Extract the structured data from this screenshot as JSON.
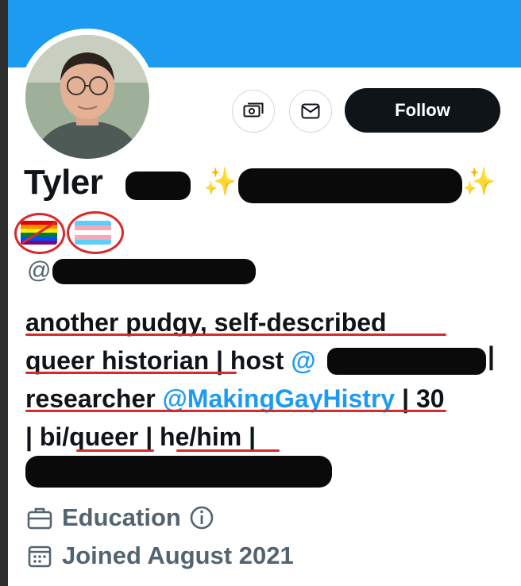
{
  "profile": {
    "name_visible": "Tyler",
    "handle_prefix": "@",
    "follow_label": "Follow",
    "tip_icon": "money-icon",
    "message_icon": "envelope-icon",
    "emoji_sparkle": "✨"
  },
  "bio": {
    "line1": "another pudgy, self-described",
    "line2_a": "queer historian",
    "line2_b": " | host ",
    "line2_mention": "@",
    "line2_end": "|",
    "line3_a": "researcher ",
    "line3_mention": "@MakingGayHistry",
    "line3_b": " | 30",
    "line4_a": "| bi/",
    "line4_queer": "queer",
    "line4_sep": " | ",
    "line4_pron": "he/him",
    "line4_end": " |"
  },
  "meta": {
    "category": "Education",
    "info_icon": "info-icon",
    "joined": "Joined August 2021"
  },
  "colors": {
    "banner": "#1d9bf0",
    "accent": "#1d9bf0",
    "annotation_red": "#d82a2a"
  }
}
